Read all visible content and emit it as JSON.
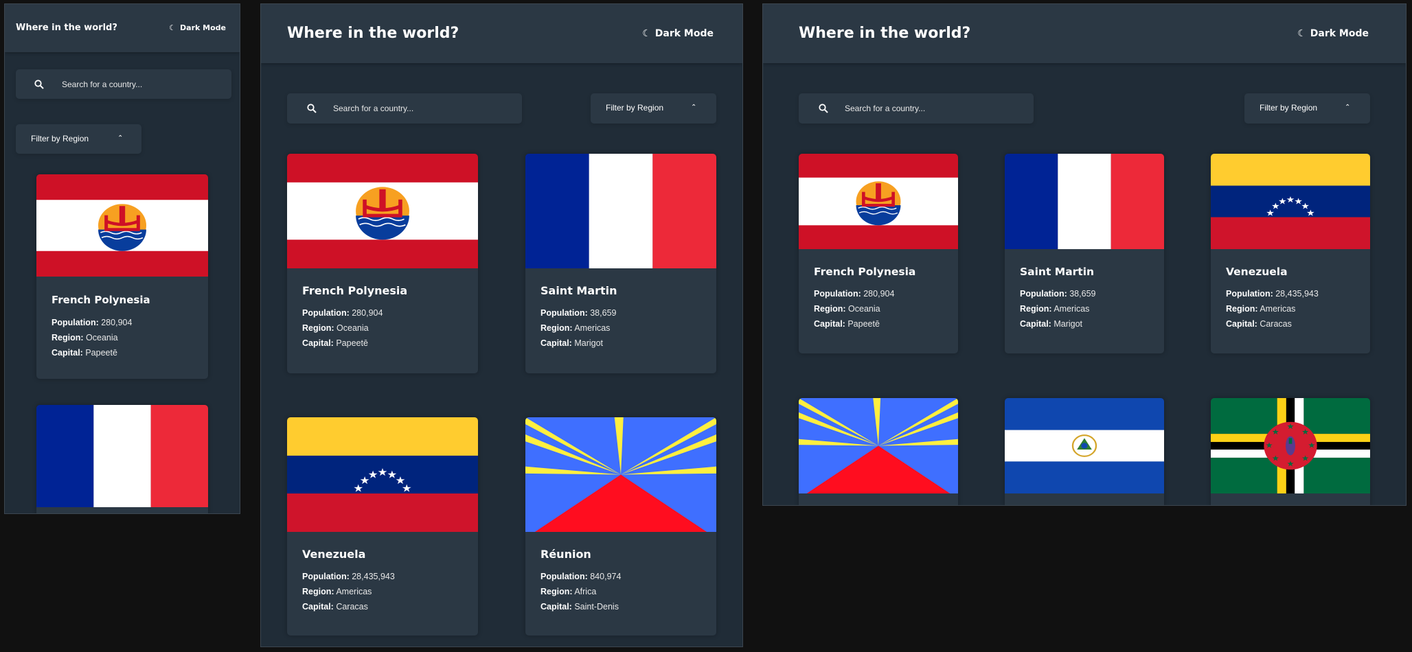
{
  "app": {
    "title": "Where in the world?",
    "dark_mode_label": "Dark Mode",
    "moon_glyph": "☾",
    "search_placeholder": "Search for a country...",
    "filter_label": "Filter by Region",
    "chevron_glyph": "⌃",
    "search_icon": "search-icon",
    "chevron_icon": "chevron-up-icon",
    "moon_icon": "moon-icon"
  },
  "labels": {
    "population": "Population:",
    "region": "Region:",
    "capital": "Capital:"
  },
  "countries": [
    {
      "name": "French Polynesia",
      "population": "280,904",
      "region": "Oceania",
      "capital": "Papeetē",
      "flag": "french-polynesia"
    },
    {
      "name": "Saint Martin",
      "population": "38,659",
      "region": "Americas",
      "capital": "Marigot",
      "flag": "saint-martin"
    },
    {
      "name": "Venezuela",
      "population": "28,435,943",
      "region": "Americas",
      "capital": "Caracas",
      "flag": "venezuela"
    },
    {
      "name": "Réunion",
      "population": "840,974",
      "region": "Africa",
      "capital": "Saint-Denis",
      "flag": "reunion"
    },
    {
      "name": "",
      "population": "",
      "region": "",
      "capital": "",
      "flag": "el-salvador"
    },
    {
      "name": "",
      "population": "",
      "region": "",
      "capital": "",
      "flag": "dominica"
    }
  ],
  "colors": {
    "background": "#202c37",
    "elements": "#2b3844",
    "outer": "#111111",
    "text": "#ffffff"
  }
}
